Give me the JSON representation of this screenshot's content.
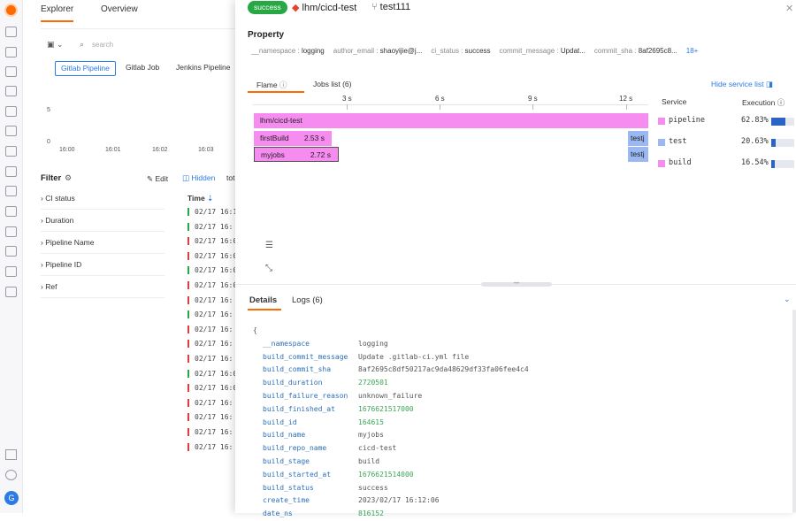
{
  "rail": {
    "avatar_letter": "G"
  },
  "explorer": {
    "tabs": [
      "Explorer",
      "Overview"
    ],
    "search_placeholder": "search",
    "segments": [
      "Gitlab Pipeline",
      "Gitlab Job",
      "Jenkins Pipeline"
    ],
    "y_ticks": [
      "5",
      "0"
    ],
    "x_ticks": [
      "16:00",
      "16:01",
      "16:02",
      "16:03"
    ],
    "filter_title": "Filter",
    "edit_label": "Edit",
    "hidden_label": "Hidden",
    "tot_label": "tot",
    "filters": [
      "CI status",
      "Duration",
      "Pipeline Name",
      "Pipeline ID",
      "Ref"
    ],
    "time_header": "Time",
    "rows": [
      {
        "t": "02/17 16:1",
        "s": "green"
      },
      {
        "t": "02/17 16:",
        "s": "green"
      },
      {
        "t": "02/17 16:0",
        "s": "red"
      },
      {
        "t": "02/17 16:0",
        "s": "red"
      },
      {
        "t": "02/17 16:0",
        "s": "green"
      },
      {
        "t": "02/17 16:0",
        "s": "red"
      },
      {
        "t": "02/17 16:",
        "s": "red"
      },
      {
        "t": "02/17 16:",
        "s": "green"
      },
      {
        "t": "02/17 16:",
        "s": "red"
      },
      {
        "t": "02/17 16:",
        "s": "red"
      },
      {
        "t": "02/17 16:",
        "s": "red"
      },
      {
        "t": "02/17 16:0",
        "s": "green"
      },
      {
        "t": "02/17 16:0",
        "s": "red"
      },
      {
        "t": "02/17 16:",
        "s": "red"
      },
      {
        "t": "02/17 16:",
        "s": "red"
      },
      {
        "t": "02/17 16:",
        "s": "red"
      },
      {
        "t": "02/17 16:",
        "s": "red"
      }
    ]
  },
  "drawer": {
    "status": "success",
    "repo": "lhm/cicd-test",
    "branch": "test111",
    "property_title": "Property",
    "properties": [
      {
        "k": "__namespace",
        "v": "logging"
      },
      {
        "k": "author_email",
        "v": "shaoyijie@j..."
      },
      {
        "k": "ci_status",
        "v": "success"
      },
      {
        "k": "commit_message",
        "v": "Updat..."
      },
      {
        "k": "commit_sha",
        "v": "8af2695c8..."
      }
    ],
    "more_props": "18+",
    "tabs": {
      "flame": "Flame",
      "jobs": "Jobs list (6)"
    },
    "hide_service": "Hide service list",
    "axis_ticks": [
      "3 s",
      "6 s",
      "9 s",
      "12 s"
    ],
    "flame": [
      {
        "name": "lhm/cicd-test",
        "dur": ""
      },
      {
        "name": "firstBuild",
        "dur": "2.53 s"
      },
      {
        "name": "myjobs",
        "dur": "2.72 s"
      },
      {
        "name": "testj",
        "dur": ""
      },
      {
        "name": "testj",
        "dur": ""
      }
    ],
    "service_header": "Service",
    "execution_header": "Execution",
    "services": [
      {
        "name": "pipeline",
        "pct": "62.83%",
        "frac": 0.6283,
        "color": "#f78cf0"
      },
      {
        "name": "test",
        "pct": "20.63%",
        "frac": 0.2063,
        "color": "#9bb8f2"
      },
      {
        "name": "build",
        "pct": "16.54%",
        "frac": 0.1654,
        "color": "#f78cf0"
      }
    ],
    "detail_tabs": {
      "details": "Details",
      "logs": "Logs (6)"
    },
    "brace": "{",
    "details": [
      {
        "k": "__namespace",
        "v": "logging",
        "num": false
      },
      {
        "k": "build_commit_message",
        "v": "Update .gitlab-ci.yml file",
        "num": false
      },
      {
        "k": "build_commit_sha",
        "v": "8af2695c8df50217ac9da48629df33fa06fee4c4",
        "num": false
      },
      {
        "k": "build_duration",
        "v": "2720501",
        "num": true
      },
      {
        "k": "build_failure_reason",
        "v": "unknown_failure",
        "num": false
      },
      {
        "k": "build_finished_at",
        "v": "1676621517000",
        "num": true
      },
      {
        "k": "build_id",
        "v": "164615",
        "num": true
      },
      {
        "k": "build_name",
        "v": "myjobs",
        "num": false
      },
      {
        "k": "build_repo_name",
        "v": "cicd-test",
        "num": false
      },
      {
        "k": "build_stage",
        "v": "build",
        "num": false
      },
      {
        "k": "build_started_at",
        "v": "1676621514000",
        "num": true
      },
      {
        "k": "build_status",
        "v": "success",
        "num": false
      },
      {
        "k": "create_time",
        "v": "2023/02/17 16:12:06",
        "num": false
      },
      {
        "k": "date_ns",
        "v": "816152",
        "num": true
      }
    ]
  }
}
